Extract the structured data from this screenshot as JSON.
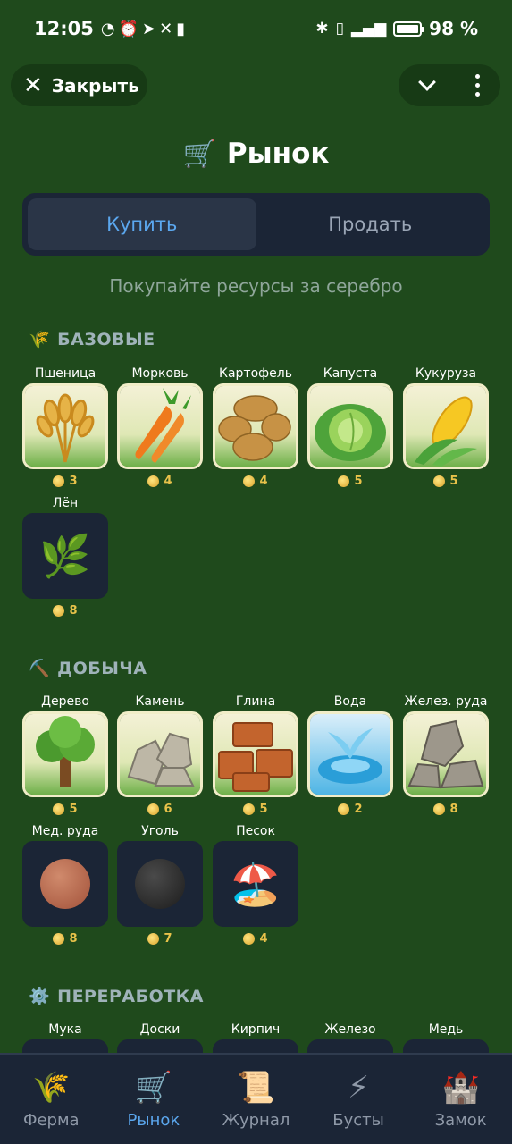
{
  "status_bar": {
    "time": "12:05",
    "left_icons": [
      "speed-icon",
      "alarm-icon",
      "telegram-icon",
      "x-icon",
      "battery-saver-icon"
    ],
    "right_icons": [
      "bluetooth-icon",
      "vibrate-icon",
      "signal-4g-icon",
      "battery-icon"
    ],
    "battery": "98 %",
    "battery_level": 0.98
  },
  "header": {
    "close_label": "Закрыть"
  },
  "page": {
    "title": "Рынок",
    "title_icon": "🛒"
  },
  "tabs": [
    {
      "label": "Купить",
      "active": true
    },
    {
      "label": "Продать",
      "active": false
    }
  ],
  "subtitle": "Покупайте ресурсы за серебро",
  "sections": {
    "basic": {
      "icon": "🌾",
      "title": "БАЗОВЫЕ",
      "items": [
        {
          "name": "Пшеница",
          "price": "3",
          "icon": "wheat-icon"
        },
        {
          "name": "Морковь",
          "price": "4",
          "icon": "carrot-icon"
        },
        {
          "name": "Картофель",
          "price": "4",
          "icon": "potato-icon"
        },
        {
          "name": "Капуста",
          "price": "5",
          "icon": "cabbage-icon"
        },
        {
          "name": "Кукуруза",
          "price": "5",
          "icon": "corn-icon"
        },
        {
          "name": "Лён",
          "price": "8",
          "icon": "flax-icon"
        }
      ]
    },
    "mining": {
      "icon": "⛏️",
      "title": "ДОБЫЧА",
      "items": [
        {
          "name": "Дерево",
          "price": "5",
          "icon": "tree-icon"
        },
        {
          "name": "Камень",
          "price": "6",
          "icon": "stone-icon"
        },
        {
          "name": "Глина",
          "price": "5",
          "icon": "clay-icon"
        },
        {
          "name": "Вода",
          "price": "2",
          "icon": "water-icon"
        },
        {
          "name": "Желез. руда",
          "price": "8",
          "icon": "iron-ore-icon"
        },
        {
          "name": "Мед. руда",
          "price": "8",
          "icon": "copper-ore-icon"
        },
        {
          "name": "Уголь",
          "price": "7",
          "icon": "coal-icon"
        },
        {
          "name": "Песок",
          "price": "4",
          "icon": "sand-icon"
        }
      ]
    },
    "processing": {
      "icon": "⚙️",
      "title": "ПЕРЕРАБОТКА",
      "items": [
        {
          "name": "Мука"
        },
        {
          "name": "Доски"
        },
        {
          "name": "Кирпич"
        },
        {
          "name": "Железо"
        },
        {
          "name": "Медь"
        }
      ]
    }
  },
  "bottom_nav": [
    {
      "label": "Ферма",
      "icon": "🌾",
      "active": false
    },
    {
      "label": "Рынок",
      "icon": "🛒",
      "active": true
    },
    {
      "label": "Журнал",
      "icon": "📜",
      "active": false
    },
    {
      "label": "Бусты",
      "icon": "⚡",
      "active": false
    },
    {
      "label": "Замок",
      "icon": "🏰",
      "active": false
    }
  ],
  "colors": {
    "background": "#1f4a1c",
    "accent": "#5ba7ee",
    "price": "#e8c24a",
    "panel": "#1b2536"
  }
}
